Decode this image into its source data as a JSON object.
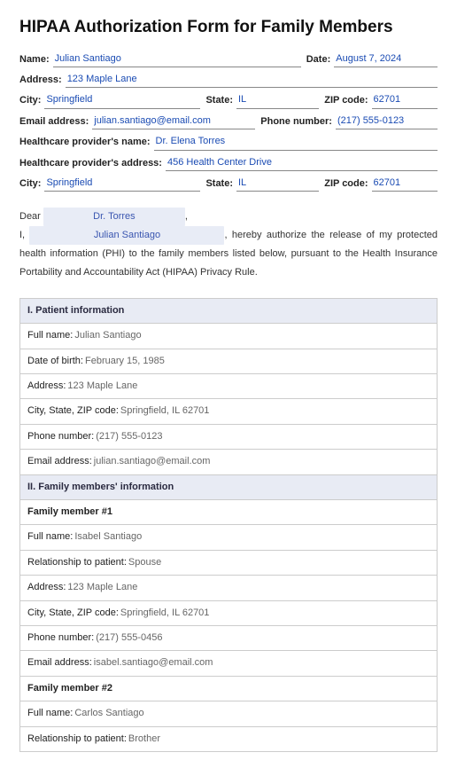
{
  "title": "HIPAA Authorization Form for Family Members",
  "header": {
    "name_label": "Name:",
    "name_value": "Julian Santiago",
    "date_label": "Date:",
    "date_value": "August 7, 2024",
    "address_label": "Address:",
    "address_value": "123 Maple Lane",
    "city_label": "City:",
    "city_value": "Springfield",
    "state_label": "State:",
    "state_value": "IL",
    "zip_label": "ZIP code:",
    "zip_value": "62701",
    "email_label": "Email address:",
    "email_value": "julian.santiago@email.com",
    "phone_label": "Phone number:",
    "phone_value": "(217) 555-0123",
    "provider_name_label": "Healthcare provider's name:",
    "provider_name_value": "Dr. Elena Torres",
    "provider_address_label": "Healthcare provider's address:",
    "provider_address_value": "456 Health Center Drive",
    "provider_city_label": "City:",
    "provider_city_value": "Springfield",
    "provider_state_label": "State:",
    "provider_state_value": "IL",
    "provider_zip_label": "ZIP code:",
    "provider_zip_value": "62701"
  },
  "letter": {
    "dear": "Dear",
    "recipient": "Dr. Torres",
    "comma": ",",
    "i": "I,",
    "author": "Julian Santiago",
    "body_after": ", hereby authorize the release of my protected health information (PHI) to the family members listed below, pursuant to the Health Insurance Portability and Accountability Act (HIPAA) Privacy Rule."
  },
  "sections": {
    "s1_title": "I. Patient information",
    "s1": {
      "fullname_l": "Full name:",
      "fullname_v": "Julian Santiago",
      "dob_l": "Date of birth:",
      "dob_v": "February 15, 1985",
      "address_l": "Address:",
      "address_v": "123 Maple Lane",
      "csz_l": "City, State, ZIP code:",
      "csz_v": "Springfield, IL 62701",
      "phone_l": "Phone number:",
      "phone_v": "(217) 555-0123",
      "email_l": "Email address:",
      "email_v": "julian.santiago@email.com"
    },
    "s2_title": "II. Family members' information",
    "fm1_title": "Family member #1",
    "fm1": {
      "fullname_l": "Full name:",
      "fullname_v": "Isabel Santiago",
      "rel_l": "Relationship to patient:",
      "rel_v": "Spouse",
      "address_l": "Address:",
      "address_v": "123 Maple Lane",
      "csz_l": "City, State, ZIP code:",
      "csz_v": "Springfield, IL 62701",
      "phone_l": "Phone number:",
      "phone_v": "(217) 555-0456",
      "email_l": "Email address:",
      "email_v": "isabel.santiago@email.com"
    },
    "fm2_title": "Family member #2",
    "fm2": {
      "fullname_l": "Full name:",
      "fullname_v": "Carlos Santiago",
      "rel_l": "Relationship to patient:",
      "rel_v": "Brother"
    }
  }
}
